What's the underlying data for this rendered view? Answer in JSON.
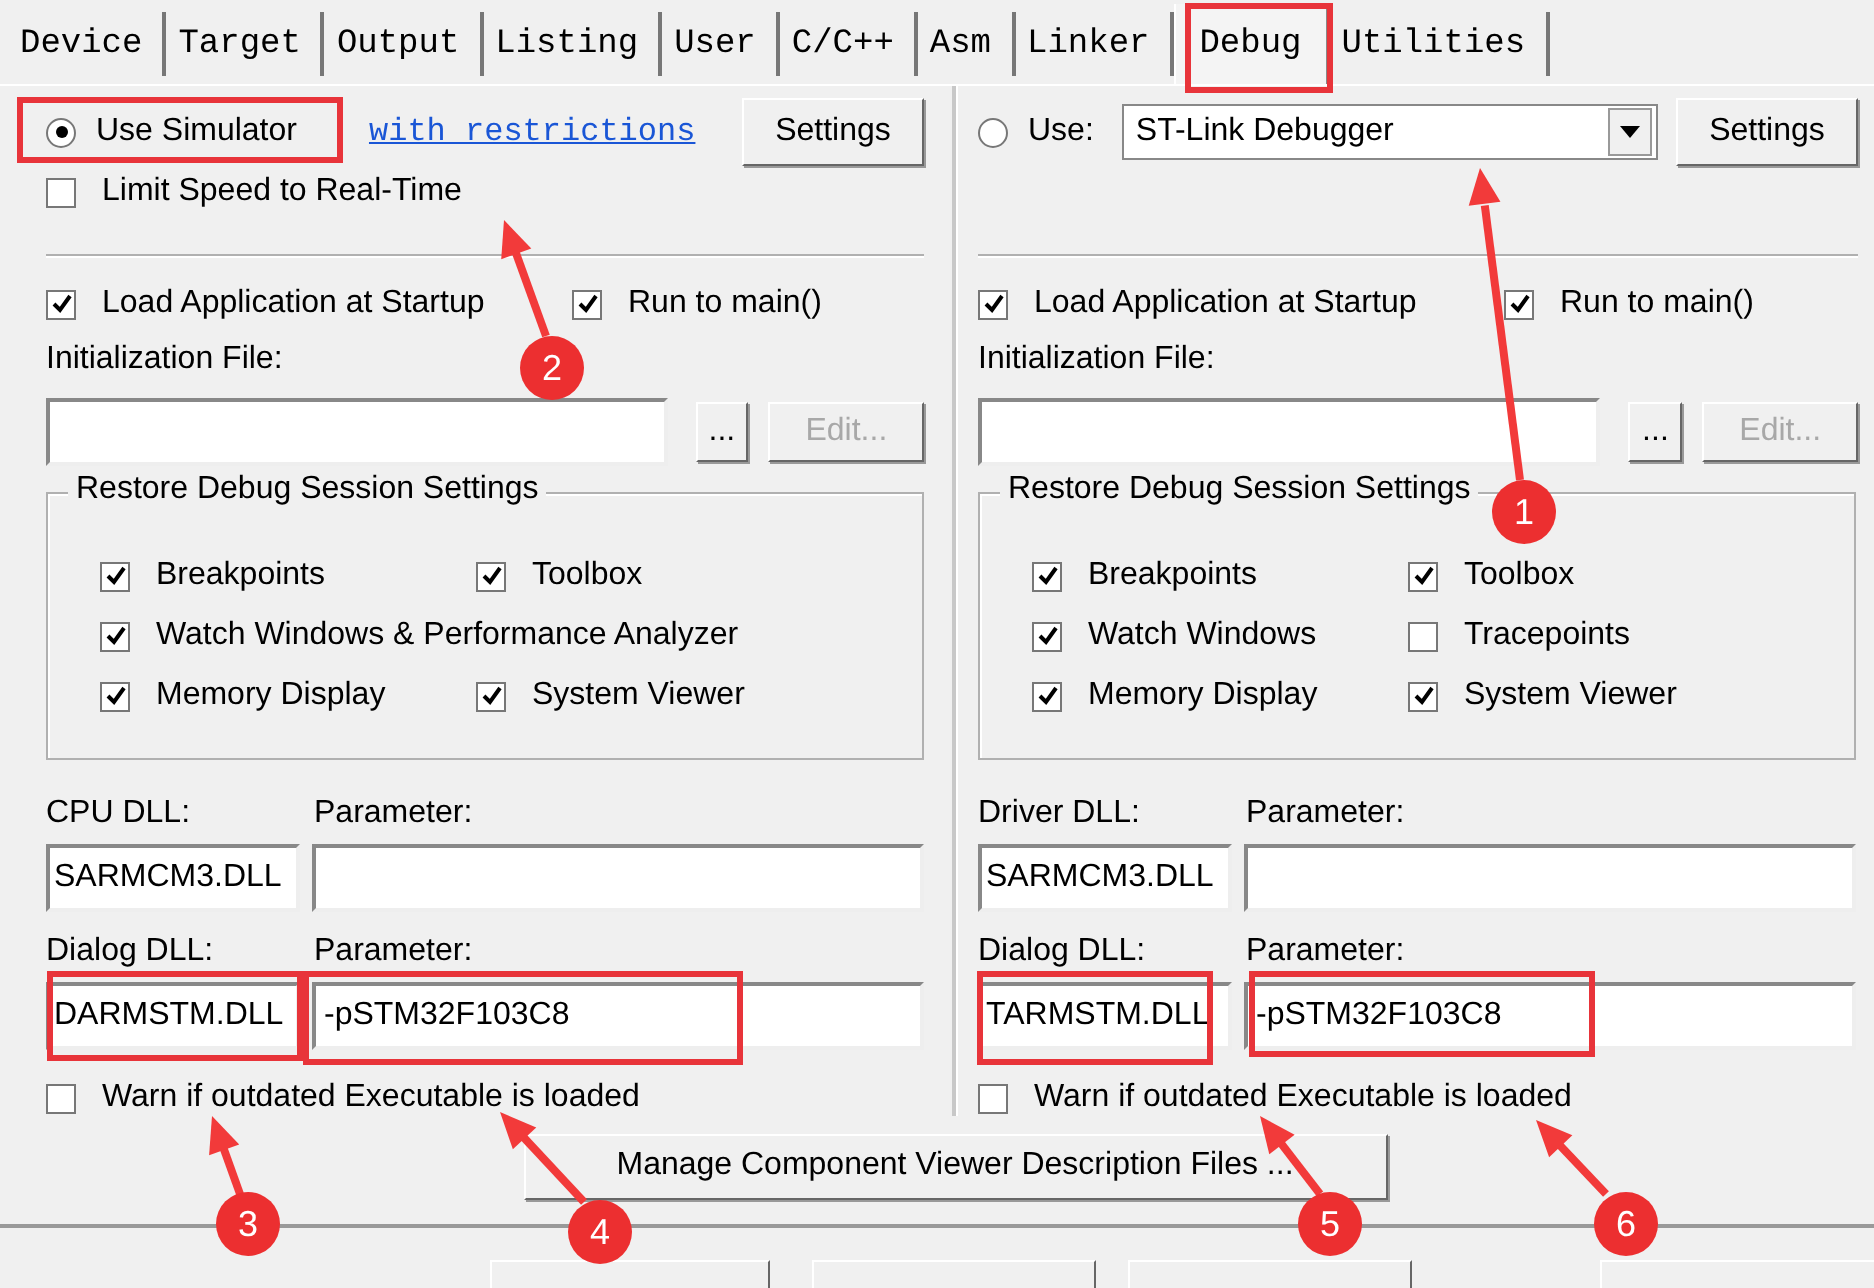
{
  "tabs": [
    {
      "label": "Device",
      "selected": false
    },
    {
      "label": "Target",
      "selected": false
    },
    {
      "label": "Output",
      "selected": false
    },
    {
      "label": "Listing",
      "selected": false
    },
    {
      "label": "User",
      "selected": false
    },
    {
      "label": "C/C++",
      "selected": false
    },
    {
      "label": "Asm",
      "selected": false
    },
    {
      "label": "Linker",
      "selected": false
    },
    {
      "label": "Debug",
      "selected": true
    },
    {
      "label": "Utilities",
      "selected": false
    }
  ],
  "panes": [
    {
      "kind": "simulator",
      "mode": {
        "label": "Use Simulator",
        "selected": true
      },
      "link": "with restrictions",
      "settings": "Settings",
      "limit_speed": {
        "label": "Limit Speed to Real-Time",
        "checked": false
      },
      "load_app": {
        "label": "Load Application at Startup",
        "checked": true
      },
      "run_to_main": {
        "label": "Run to main()",
        "checked": true
      },
      "init_label": "Initialization File:",
      "browse": "...",
      "edit": {
        "label": "Edit...",
        "disabled": true
      },
      "restore": {
        "title": "Restore Debug Session Settings",
        "rows": [
          [
            {
              "label": "Breakpoints",
              "checked": true
            },
            {
              "label": "Toolbox",
              "checked": true
            }
          ],
          [
            {
              "label": "Watch Windows & Performance Analyzer",
              "checked": true
            }
          ],
          [
            {
              "label": "Memory Display",
              "checked": true
            },
            {
              "label": "System Viewer",
              "checked": true
            }
          ]
        ]
      },
      "dll_label": "CPU DLL:",
      "dll_value": "SARMCM3.DLL",
      "param_label": "Parameter:",
      "dialog_label": "Dialog DLL:",
      "dialog_value": "DARMSTM.DLL",
      "dialog_param_label": "Parameter:",
      "dialog_param_value": "-pSTM32F103C8",
      "warn": {
        "label": "Warn if outdated Executable is loaded",
        "checked": false
      }
    },
    {
      "kind": "target",
      "mode": {
        "label": "Use:",
        "selected": false
      },
      "driver": "ST-Link Debugger",
      "settings": "Settings",
      "load_app": {
        "label": "Load Application at Startup",
        "checked": true
      },
      "run_to_main": {
        "label": "Run to main()",
        "checked": true
      },
      "init_label": "Initialization File:",
      "browse": "...",
      "edit": {
        "label": "Edit...",
        "disabled": true
      },
      "restore": {
        "title": "Restore Debug Session Settings",
        "rows": [
          [
            {
              "label": "Breakpoints",
              "checked": true
            },
            {
              "label": "Toolbox",
              "checked": true
            }
          ],
          [
            {
              "label": "Watch Windows",
              "checked": true
            },
            {
              "label": "Tracepoints",
              "checked": false
            }
          ],
          [
            {
              "label": "Memory Display",
              "checked": true
            },
            {
              "label": "System Viewer",
              "checked": true
            }
          ]
        ]
      },
      "dll_label": "Driver DLL:",
      "dll_value": "SARMCM3.DLL",
      "param_label": "Parameter:",
      "dialog_label": "Dialog DLL:",
      "dialog_value": "TARMSTM.DLL",
      "dialog_param_label": "Parameter:",
      "dialog_param_value": "-pSTM32F103C8",
      "warn": {
        "label": "Warn if outdated Executable is loaded",
        "checked": false
      }
    }
  ],
  "manage_button": "Manage Component Viewer Description Files ...",
  "annotations": [
    {
      "number": "1"
    },
    {
      "number": "2"
    },
    {
      "number": "3"
    },
    {
      "number": "4"
    },
    {
      "number": "5"
    },
    {
      "number": "6"
    }
  ]
}
